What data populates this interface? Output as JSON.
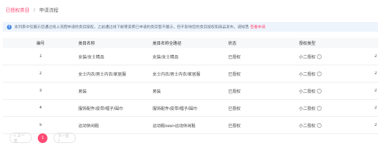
{
  "breadcrumb": {
    "link": "已授权类目",
    "separator": "/",
    "current": "申请流程"
  },
  "notice": {
    "icon": "info-icon",
    "text": "本列表中仅展示您通过线上流程申请的类目授权，之前通过线下邮寄资质已申请的类目暂不展示，但不影响您的类目授权和商品发布，请知悉",
    "link": "查看申请"
  },
  "table": {
    "headers": [
      "编号",
      "类目名称",
      "类目名称全路径",
      "状态",
      "授权类型",
      ""
    ],
    "rows": [
      {
        "num": "1",
        "name": "女装/女士精品",
        "path": "女装/女士精品",
        "status": "已授权",
        "type": "小二授权",
        "extra": "2"
      },
      {
        "num": "2",
        "name": "女士内衣/男士内衣/家居服",
        "path": "女士内衣/男士内衣/家居服",
        "status": "已授权",
        "type": "小二授权",
        "extra": "2"
      },
      {
        "num": "3",
        "name": "男装",
        "path": "男装",
        "status": "已授权",
        "type": "小二授权",
        "extra": "2"
      },
      {
        "num": "4",
        "name": "服饰配件/皮带/帽子/围巾",
        "path": "服饰配件/皮带/帽子/围巾",
        "status": "已授权",
        "type": "小二授权",
        "extra": "2"
      },
      {
        "num": "5",
        "name": "运动休闲鞋",
        "path": "运动鞋new>运动休闲鞋",
        "status": "已授权",
        "type": "小二授权",
        "extra": "2"
      }
    ],
    "help_icon": "question-circle-icon"
  },
  "pagination": {
    "prev": "< 上一页",
    "current": "1",
    "next": "下一页 >"
  },
  "colors": {
    "accent": "#ff4a73",
    "notice_bg": "#eef4fc",
    "header_bg": "#f7f8fa"
  }
}
